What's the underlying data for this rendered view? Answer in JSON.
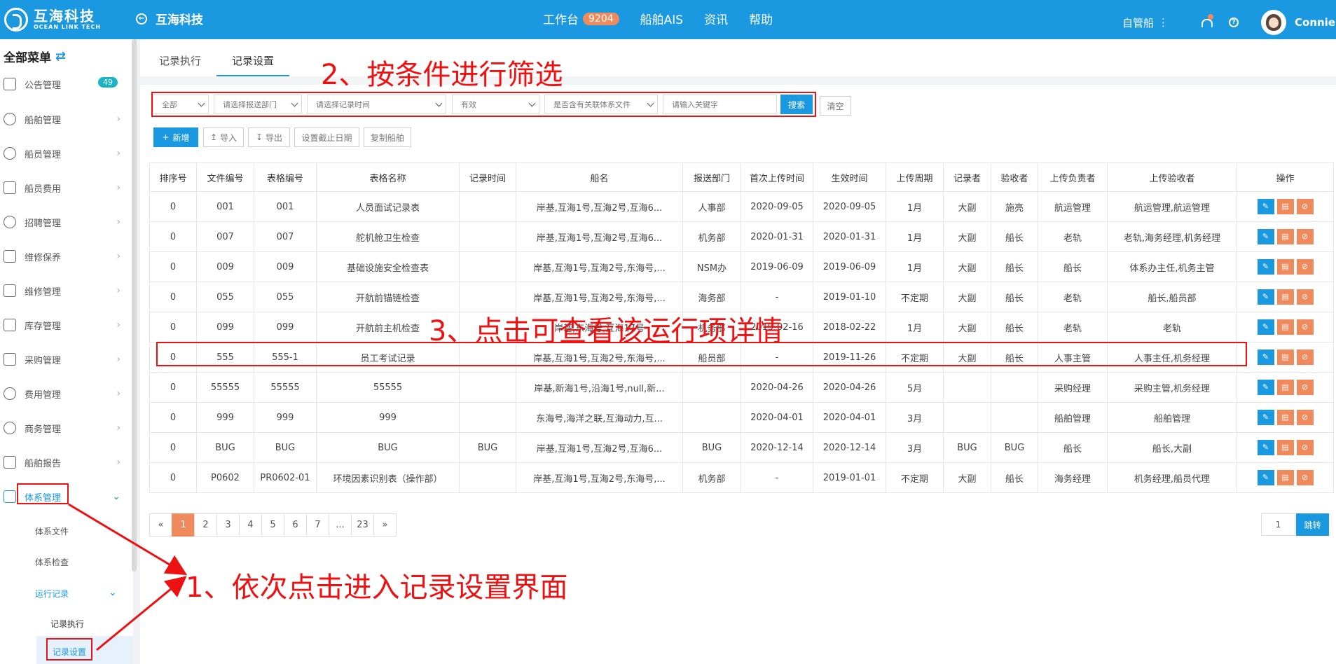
{
  "brand": {
    "name_cn": "互海科技",
    "name_en": "OCEAN LINK TECH"
  },
  "back": {
    "label": "互海科技"
  },
  "topnav": {
    "workbench": "工作台",
    "workbench_count": "9204",
    "ais": "船舶AIS",
    "news": "资讯",
    "help": "帮助"
  },
  "topright": {
    "mode": "自管船",
    "user": "Connie"
  },
  "sidebar": {
    "title": "全部菜单",
    "items": [
      {
        "label": "公告管理",
        "badge": "49"
      },
      {
        "label": "船舶管理"
      },
      {
        "label": "船员管理"
      },
      {
        "label": "船员费用"
      },
      {
        "label": "招聘管理"
      },
      {
        "label": "维修保养"
      },
      {
        "label": "维修管理"
      },
      {
        "label": "库存管理"
      },
      {
        "label": "采购管理"
      },
      {
        "label": "费用管理"
      },
      {
        "label": "商务管理"
      },
      {
        "label": "船舶报告"
      },
      {
        "label": "体系管理"
      }
    ],
    "sub": {
      "file": "体系文件",
      "check": "体系检查",
      "run": "运行记录",
      "exec": "记录执行",
      "setting": "记录设置"
    }
  },
  "tabs": {
    "exec": "记录执行",
    "setting": "记录设置"
  },
  "filters": {
    "all": "全部",
    "dept": "请选择报送部门",
    "time": "请选择记录时间",
    "valid": "有效",
    "related": "是否含有关联体系文件",
    "keyword_placeholder": "请输入关键字",
    "search": "搜索",
    "clear": "清空"
  },
  "actions": {
    "add": "新增",
    "import": "导入",
    "export": "导出",
    "deadline": "设置截止日期",
    "copy": "复制船舶"
  },
  "table": {
    "headers": [
      "排序号",
      "文件编号",
      "表格编号",
      "表格名称",
      "记录时间",
      "船名",
      "报送部门",
      "首次上传时间",
      "生效时间",
      "上传周期",
      "记录者",
      "验收者",
      "上传负责者",
      "上传验收者",
      "操作"
    ],
    "rows": [
      [
        "0",
        "001",
        "001",
        "人员面试记录表",
        "",
        "岸基,互海1号,互海2号,互海6...",
        "人事部",
        "2020-09-05",
        "2020-09-05",
        "1月",
        "大副",
        "施亮",
        "航运管理",
        "航运管理,航运管理"
      ],
      [
        "0",
        "007",
        "007",
        "舵机舱卫生检查",
        "",
        "岸基,互海1号,互海2号,互海6...",
        "机务部",
        "2020-01-31",
        "2020-01-31",
        "1月",
        "大副",
        "船长",
        "老轨",
        "老轨,海务经理,机务经理"
      ],
      [
        "0",
        "009",
        "009",
        "基础设施安全检查表",
        "",
        "岸基,互海1号,互海2号,东海号,...",
        "NSM办",
        "2019-06-09",
        "2019-06-09",
        "1月",
        "大副",
        "船长",
        "船长",
        "体系办主任,机务主管"
      ],
      [
        "0",
        "055",
        "055",
        "开航前锚链检查",
        "",
        "岸基,互海1号,互海2号,东海号,...",
        "海务部",
        "-",
        "2019-01-10",
        "不定期",
        "大副",
        "船长",
        "老轨",
        "船长,船员部"
      ],
      [
        "0",
        "099",
        "099",
        "开航前主机检查",
        "",
        "岸基,东海号,互海17号",
        "机务部",
        "2019-02-16",
        "2018-02-22",
        "1月",
        "大副",
        "船长",
        "老轨",
        "老轨"
      ],
      [
        "0",
        "555",
        "555-1",
        "员工考试记录",
        "",
        "岸基,互海1号,互海2号,东海号,...",
        "船员部",
        "-",
        "2019-11-26",
        "不定期",
        "大副",
        "船长",
        "人事主管",
        "人事主任,机务经理"
      ],
      [
        "0",
        "55555",
        "55555",
        "55555",
        "",
        "岸基,新海1号,沿海1号,null,新...",
        "",
        "2020-04-26",
        "2020-04-26",
        "5月",
        "",
        "",
        "采购经理",
        "采购主管,机务经理"
      ],
      [
        "0",
        "999",
        "999",
        "999",
        "",
        "东海号,海洋之联,互海动力,互...",
        "",
        "2020-04-01",
        "2020-04-01",
        "3月",
        "",
        "",
        "船舶管理",
        "船舶管理"
      ],
      [
        "0",
        "BUG",
        "BUG",
        "BUG",
        "BUG",
        "岸基,互海1号,互海2号,互海6...",
        "BUG",
        "2020-12-14",
        "2020-12-14",
        "3月",
        "BUG",
        "BUG",
        "船长",
        "船长,大副"
      ],
      [
        "0",
        "P0602",
        "PR0602-01",
        "环境因素识别表（操作部）",
        "",
        "岸基,互海1号,互海2号,东海号,...",
        "机务部",
        "-",
        "2019-01-01",
        "不定期",
        "大副",
        "船长",
        "海务经理",
        "机务经理,船员代理"
      ]
    ]
  },
  "pagination": {
    "prev": "«",
    "next": "»",
    "pages": [
      "1",
      "2",
      "3",
      "4",
      "5",
      "6",
      "7",
      "...",
      "23"
    ],
    "current": "1",
    "jump_value": "1",
    "jump_label": "跳转"
  },
  "annotations": {
    "step1": "1、依次点击进入记录设置界面",
    "step2": "2、按条件进行筛选",
    "step3": "3、点击可查看该运行项详情"
  },
  "colors": {
    "primary": "#1a98e0",
    "accent": "#f08a5d",
    "annotation": "#e11111"
  }
}
